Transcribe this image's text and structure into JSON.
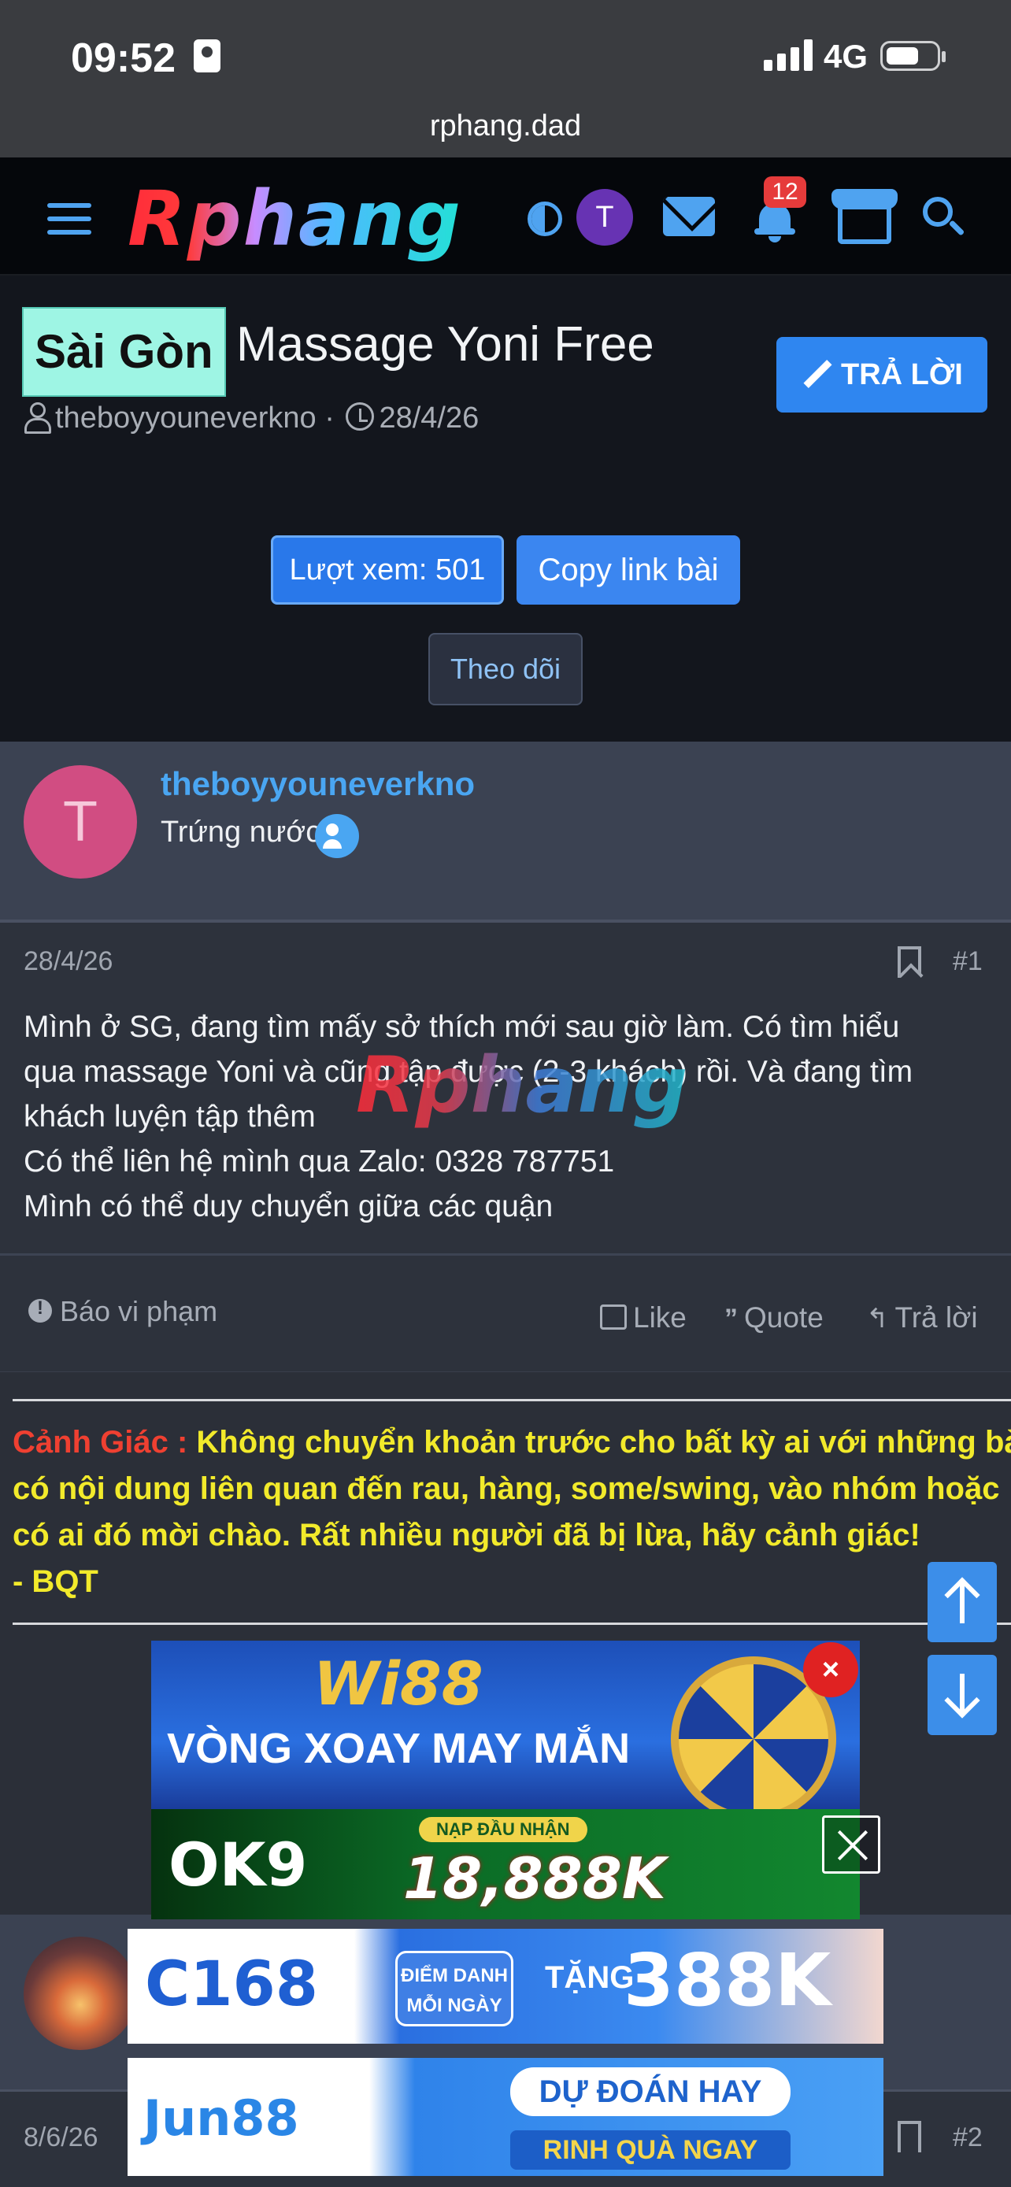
{
  "status_bar": {
    "time": "09:52",
    "network": "4G"
  },
  "browser": {
    "url": "rphang.dad"
  },
  "header": {
    "logo": "Rphang",
    "avatar_letter": "T",
    "notification_count": "12",
    "icons": [
      "menu-icon",
      "theme-toggle-icon",
      "mail-icon",
      "bell-icon",
      "store-icon",
      "search-icon"
    ],
    "accent_color": "#4fa3f0"
  },
  "thread": {
    "prefix": "Sài Gòn",
    "title": "Massage Yoni Free",
    "author": "theboyyouneverkno",
    "date": "28/4/26",
    "reply_label": "TRẢ LỜI",
    "views_label": "Lượt xem: 501",
    "copy_label": "Copy link bài",
    "follow_label": "Theo dõi"
  },
  "post1": {
    "avatar_letter": "T",
    "username": "theboyyouneverkno",
    "rank": "Trứng nước",
    "date": "28/4/26",
    "number": "#1",
    "lines": [
      "Mình ở SG, đang tìm mấy sở thích mới sau giờ làm. Có tìm hiểu",
      "qua massage Yoni và cũng tập được (2-3 khách) rồi. Và đang tìm",
      "khách luyện tập thêm",
      "Có thể liên hệ mình qua Zalo: 0328 787751",
      "Mình có thể duy chuyển giữa các quận"
    ],
    "watermark": "Rphang",
    "report_label": "Báo vi phạm",
    "like_label": "Like",
    "quote_label": "Quote",
    "reply_label": "Trả lời"
  },
  "warning": {
    "label": "Cảnh Giác :",
    "line1": "Không chuyển khoản trước cho bất kỳ ai với những bài",
    "line2": "có nội dung liên quan đến rau, hàng, some/swing, vào nhóm hoặc",
    "line3": "có ai đó mời chào. Rất nhiều người đã bị lừa, hãy cảnh giác!",
    "line4": "- BQT"
  },
  "ads": {
    "ad1_brand": "Wi88",
    "ad1_text": "VÒNG XOAY MAY MẮN",
    "ad1_close": "×",
    "ad2_brand": "OK9",
    "ad2_pill": "NẠP ĐẦU NHẬN",
    "ad2_amount": "18,888K",
    "ad3_brand": "C168",
    "ad3_box": "ĐIỂM DANH MỖI NGÀY",
    "ad3_tang": "TẶNG",
    "ad3_amount": "388K",
    "ad4_brand": "Jun88",
    "ad4_title": "DỰ ĐOÁN HAY",
    "ad4_sub": "RINH QUÀ NGAY"
  },
  "post2": {
    "date": "8/6/26",
    "number": "#2"
  }
}
